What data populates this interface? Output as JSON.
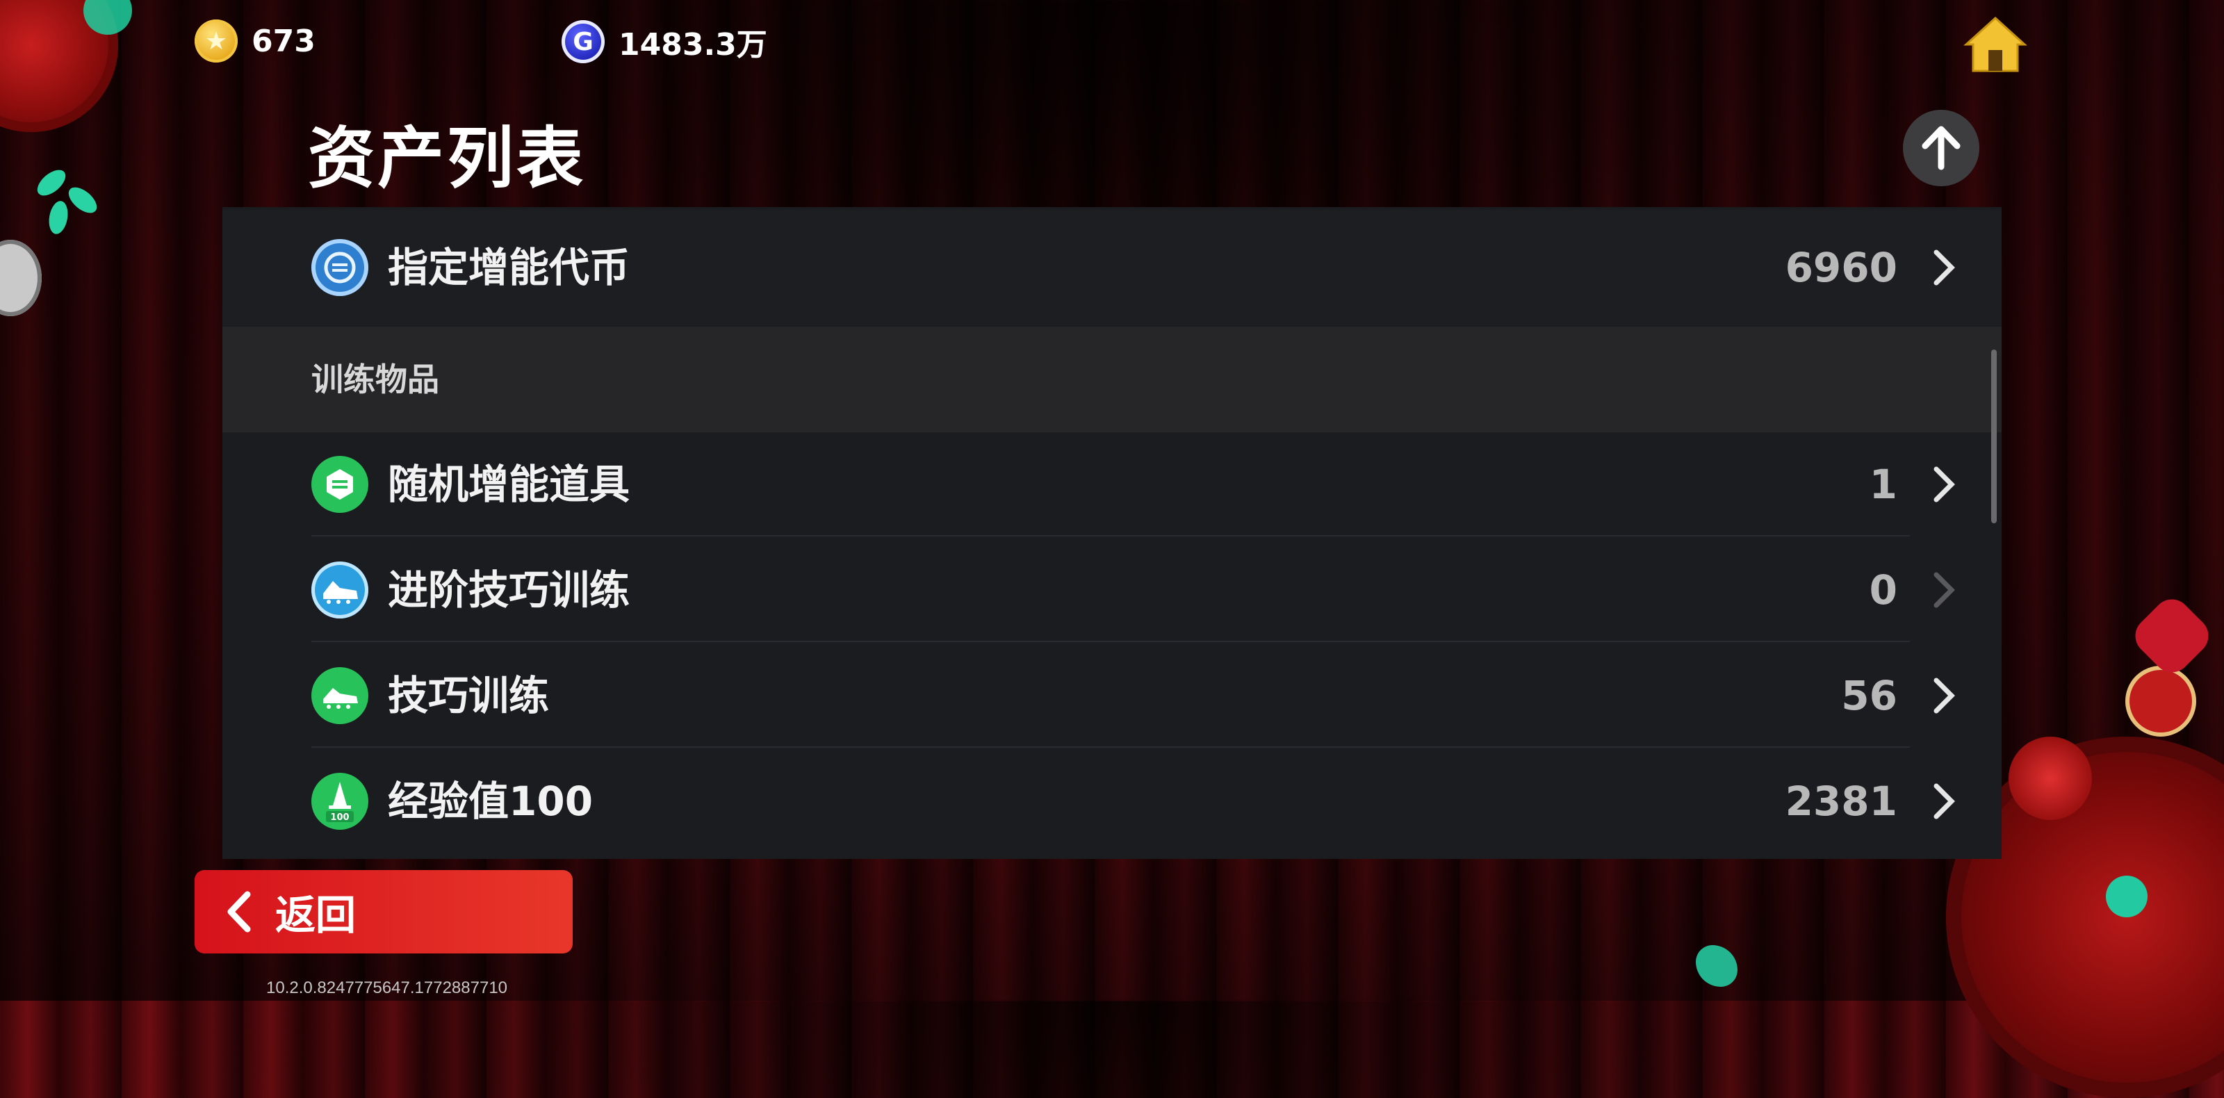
{
  "currencies": {
    "coins": {
      "icon": "star-coin-icon",
      "value": "673"
    },
    "gpoints": {
      "icon": "g-coin-icon",
      "glyph": "G",
      "value": "1483.3万"
    }
  },
  "page": {
    "title": "资产列表"
  },
  "list": {
    "top_item": {
      "label": "指定增能代币",
      "count": "6960",
      "icon": "boost-token-icon"
    },
    "section_title": "训练物品",
    "items": [
      {
        "label": "随机增能道具",
        "count": "1",
        "icon": "random-boost-icon",
        "icon_color": "#27c35a",
        "disabled": false
      },
      {
        "label": "进阶技巧训练",
        "count": "0",
        "icon": "advanced-boot-icon",
        "icon_color": "#2b9fe0",
        "disabled": true
      },
      {
        "label": "技巧训练",
        "count": "56",
        "icon": "boot-icon",
        "icon_color": "#27c35a",
        "disabled": false
      },
      {
        "label": "经验值100",
        "count": "2381",
        "icon": "cone-icon",
        "icon_color": "#27c35a",
        "icon_text": "100",
        "disabled": false
      }
    ]
  },
  "footer": {
    "back_label": "返回",
    "version": "10.2.0.8247775647.1772887710"
  },
  "colors": {
    "accent_red": "#d5121b",
    "panel_bg": "#1b1c20",
    "green": "#27c35a",
    "blue": "#2b9fe0"
  }
}
